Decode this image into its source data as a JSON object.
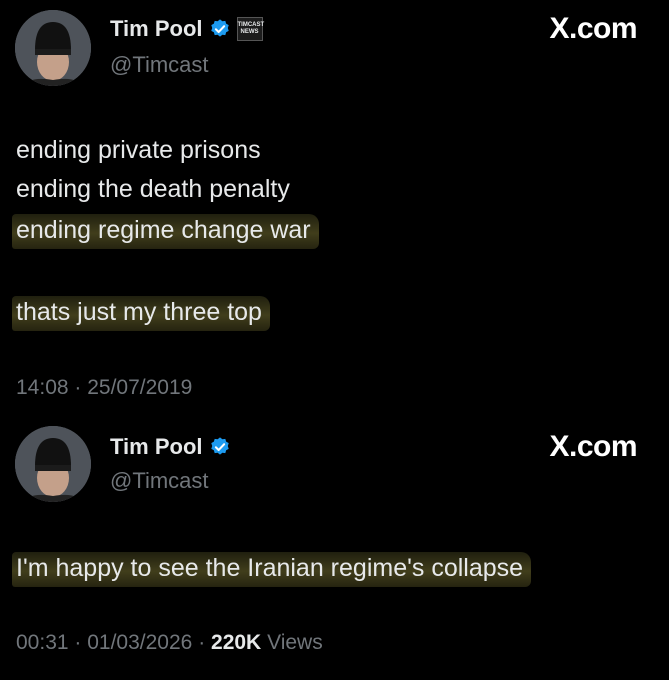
{
  "posts": [
    {
      "author": {
        "name": "Tim Pool",
        "handle": "@Timcast",
        "org_badge": [
          "TIMCAST",
          "NEWS"
        ]
      },
      "source": "X.com",
      "lines": [
        "ending private prisons",
        "ending the death penalty",
        "ending regime change war",
        "thats just my three top"
      ],
      "time": "14:08",
      "date": "25/07/2019"
    },
    {
      "author": {
        "name": "Tim Pool",
        "handle": "@Timcast"
      },
      "source": "X.com",
      "lines": [
        "I'm happy to see the Iranian regime's collapse"
      ],
      "time": "00:31",
      "date": "01/03/2026",
      "views_count": "220K",
      "views_label": "Views"
    }
  ],
  "colors": {
    "background": "#000000",
    "text": "#e7e9ea",
    "muted": "#71767b",
    "verified": "#1d9bf0",
    "highlight": "#aaa248"
  },
  "icons": {
    "verified": "verified-badge-icon",
    "avatar": "avatar"
  }
}
